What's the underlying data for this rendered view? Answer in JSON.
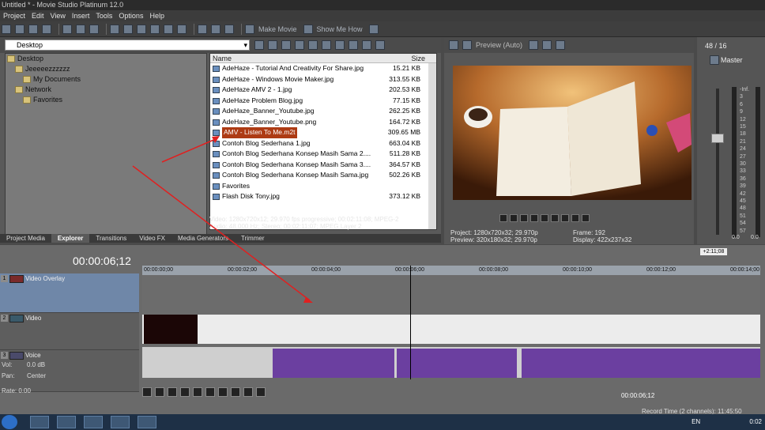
{
  "title": "Untitled * - Movie Studio Platinum 12.0",
  "menu": [
    "Project",
    "Edit",
    "View",
    "Insert",
    "Tools",
    "Options",
    "Help"
  ],
  "toolbar": {
    "make_movie": "Make Movie",
    "show_me_how": "Show Me How"
  },
  "explorer": {
    "address": "Desktop",
    "tree": [
      "Desktop",
      "Jeeeeezzzzzz",
      "My Documents",
      "Network",
      "Favorites"
    ],
    "columns": {
      "name": "Name",
      "size": "Size"
    },
    "files": [
      {
        "name": "AdeHaze - Tutorial And Creativity For Share.jpg",
        "size": "15.21 KB"
      },
      {
        "name": "AdeHaze - Windows Movie Maker.jpg",
        "size": "313.55 KB"
      },
      {
        "name": "AdeHaze AMV 2 - 1.jpg",
        "size": "202.53 KB"
      },
      {
        "name": "AdeHaze Problem Blog.jpg",
        "size": "77.15 KB"
      },
      {
        "name": "AdeHaze_Banner_Youtube.jpg",
        "size": "262.25 KB"
      },
      {
        "name": "AdeHaze_Banner_Youtube.png",
        "size": "164.72 KB"
      },
      {
        "name": "AMV - Listen To Me.m2t",
        "size": "309.65 MB"
      },
      {
        "name": "Contoh Blog Sederhana 1.jpg",
        "size": "663.04 KB"
      },
      {
        "name": "Contoh Blog Sederhana Konsep Masih Sama 2....",
        "size": "511.28 KB"
      },
      {
        "name": "Contoh Blog Sederhana Konsep Masih Sama 3....",
        "size": "364.57 KB"
      },
      {
        "name": "Contoh Blog Sederhana Konsep Masih Sama.jpg",
        "size": "502.26 KB"
      },
      {
        "name": "Favorites",
        "size": ""
      },
      {
        "name": "Flash Disk Tony.jpg",
        "size": "373.12 KB"
      }
    ],
    "info_video": "Video: 1280x720x12; 29.970 fps progressive; 00:02:11:08; MPEG-2",
    "info_audio": "Audio: 48,000 Hz; Stereo; 00:02:11:07; MPEG Layer 2"
  },
  "tabs": [
    "Project Media",
    "Explorer",
    "Transitions",
    "Video FX",
    "Media Generators",
    "Trimmer"
  ],
  "preview": {
    "mode": "Preview (Auto)",
    "project": "Project:   1280x720x32; 29.970p",
    "preview_res": "Preview:  320x180x32; 29.970p",
    "frame": "Frame:     192",
    "display": "Display:   422x237x32"
  },
  "master": {
    "bus": "48 / 16",
    "label": "Master",
    "scale": [
      "-Inf.",
      "3",
      "6",
      "9",
      "12",
      "15",
      "18",
      "21",
      "24",
      "27",
      "30",
      "33",
      "36",
      "39",
      "42",
      "45",
      "48",
      "51",
      "54",
      "57"
    ],
    "bottom": [
      "0.0",
      "0.0"
    ]
  },
  "timeline": {
    "time": "00:00:06;12",
    "marker": "+2:11;08",
    "ruler": [
      "00:00:00;00",
      "00:00:02;00",
      "00:00:04;00",
      "00:00:06;00",
      "00:00:08;00",
      "00:00:10;00",
      "00:00:12;00",
      "00:00:14;00"
    ],
    "tracks": [
      {
        "num": "1",
        "name": "Video Overlay"
      },
      {
        "num": "2",
        "name": "Video"
      },
      {
        "num": "3",
        "name": "Voice",
        "vol": "Vol:",
        "vol_value": "0.0 dB",
        "pan": "Pan:",
        "pan_value": "Center"
      }
    ],
    "rate": "Rate: 0.00",
    "cursor_time": "00:00:06;12",
    "record": "Record Time (2 channels): 11:45:50"
  },
  "taskbar": {
    "lang": "EN",
    "clock": "0:02"
  }
}
